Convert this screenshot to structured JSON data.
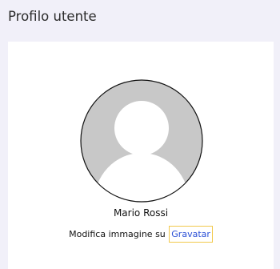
{
  "header": {
    "title": "Profilo utente"
  },
  "profile": {
    "avatar_icon": "default-user-avatar-icon",
    "name": "Mario Rossi",
    "edit_prefix": "Modifica immagine su",
    "edit_link": "Gravatar"
  },
  "colors": {
    "background": "#f1f0f9",
    "card": "#ffffff",
    "avatar_bg": "#c8c8c8",
    "link": "#2a4fd6",
    "focus_outline": "#f2c94c"
  }
}
